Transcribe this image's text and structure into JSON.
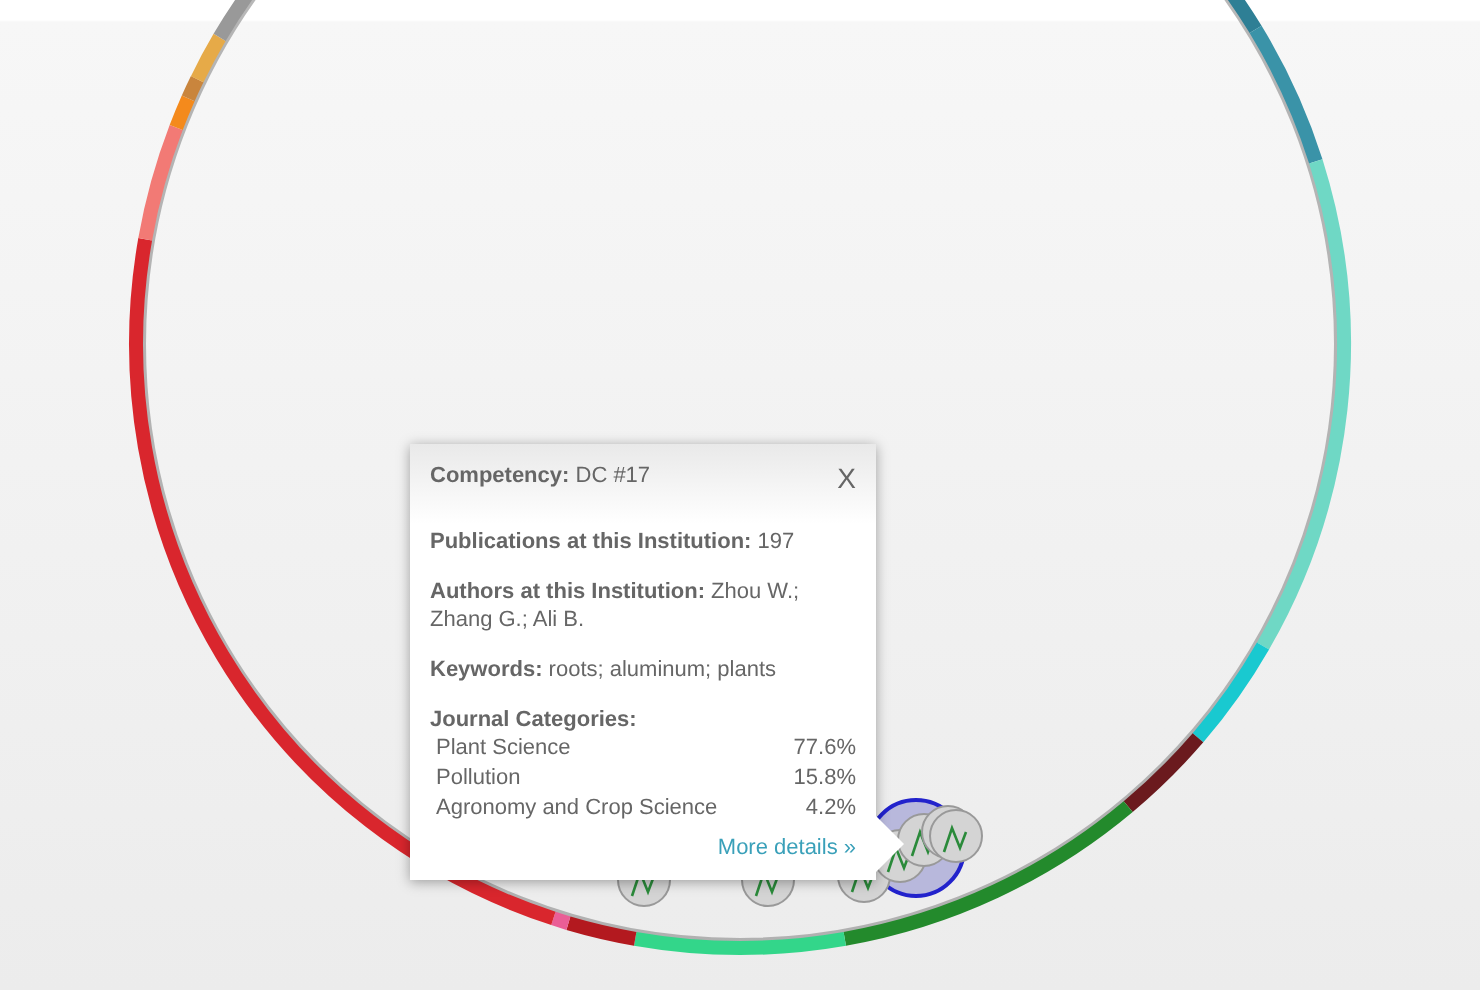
{
  "tooltip": {
    "close": "X",
    "fields": [
      {
        "label": "Competency:",
        "value": "DC #17"
      },
      {
        "label": "Publications at this Institution:",
        "value": "197"
      },
      {
        "label": "Authors at this Institution:",
        "value": "Zhou W.; Zhang G.; Ali B."
      },
      {
        "label": "Keywords:",
        "value": "roots; aluminum; plants"
      }
    ],
    "categories_label": "Journal Categories:",
    "categories": [
      {
        "name": "Plant Science",
        "share": "77.6%"
      },
      {
        "name": "Pollution",
        "share": "15.8%"
      },
      {
        "name": "Agronomy and Crop Science",
        "share": "4.2%"
      }
    ],
    "link": "More details »"
  }
}
